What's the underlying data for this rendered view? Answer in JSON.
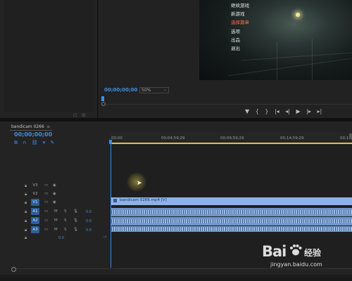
{
  "program": {
    "menu_items": [
      "继续游戏",
      "新游戏",
      "选择篇章",
      "选项",
      "出品",
      "退出"
    ],
    "selected_menu_item": "选择篇章",
    "timecode": "00;00;00;00",
    "zoom": "50%",
    "transport_icons": [
      "marker-icon",
      "mark-in-icon",
      "mark-out-icon",
      "go-to-in-icon",
      "step-back-icon",
      "play-icon",
      "step-forward-icon",
      "go-to-out-icon",
      "more-icon"
    ]
  },
  "timeline": {
    "sequence_name": "bandicam 0266",
    "close_glyph": "≡",
    "timecode": "00;00;00;00",
    "ruler_labels": [
      "00;00",
      "00;04;59;29",
      "00;09;59;29",
      "00;14;59;29",
      "00;19;59;29"
    ],
    "video_tracks": [
      {
        "label": "V3",
        "active": false
      },
      {
        "label": "V2",
        "active": false
      },
      {
        "label": "V1",
        "active": true
      }
    ],
    "audio_tracks": [
      {
        "label": "A1",
        "volume": "0.0"
      },
      {
        "label": "A2",
        "volume": "0.0"
      },
      {
        "label": "A3",
        "volume": "0.0"
      }
    ],
    "master_volume": "0.0",
    "video_clip_label": "bandicam 0266.mp4 [V]",
    "mute_label": "M",
    "solo_label": "S"
  },
  "watermark": {
    "brand": "Bai",
    "brand_cn": "经验",
    "url": "jingyan.baidu.com"
  },
  "colors": {
    "accent": "#3d8ee6",
    "clip_video": "#8fb2e6",
    "clip_audio": "#6f95c8",
    "work_area": "#d9c63a",
    "menu_selected": "#ff6a45"
  }
}
